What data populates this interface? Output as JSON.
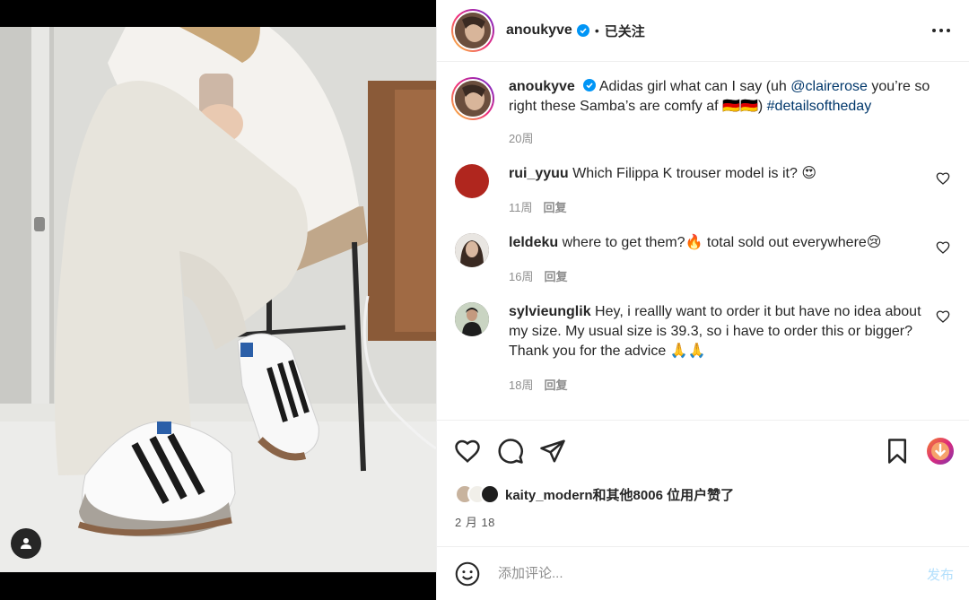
{
  "post": {
    "username": "anoukyve",
    "follow_status": "已关注",
    "dot": "•"
  },
  "caption": {
    "username": "anoukyve",
    "text_before": "Adidas girl what can I say (uh ",
    "mention": "@clairerose",
    "text_middle": " you’re so right these Samba’s are comfy af 🇩🇪🇩🇪) ",
    "hashtag": "#detailsoftheday",
    "time": "20周"
  },
  "comments": [
    {
      "username": "rui_yyuu",
      "text": "Which Filippa K trouser model is it? 😍",
      "time": "11周",
      "reply": "回复",
      "avatar_color": "#b0261e"
    },
    {
      "username": "leldeku",
      "text": "where to get them?🔥 total sold out everywhere😢",
      "time": "16周",
      "reply": "回复",
      "avatar_color": "#4a3b33"
    },
    {
      "username": "sylvieunglik",
      "text": "Hey, i reallly want to order it but have no idea about my size. My usual size is 39.3, so i have to order this or bigger? Thank you for the advice 🙏🙏",
      "time": "18周",
      "reply": "回复",
      "avatar_color": "#3c3c3c"
    }
  ],
  "likes": {
    "top_liker": "kaity_modern",
    "text": "和其他8006 位用户赞了"
  },
  "date": "2 月 18",
  "comment_box": {
    "placeholder": "添加评论...",
    "post_label": "发布"
  },
  "colors": {
    "link": "#00376b",
    "verified": "#0095f6",
    "secondary_text": "#8e8e8e",
    "post_disabled": "#b2dffc"
  }
}
